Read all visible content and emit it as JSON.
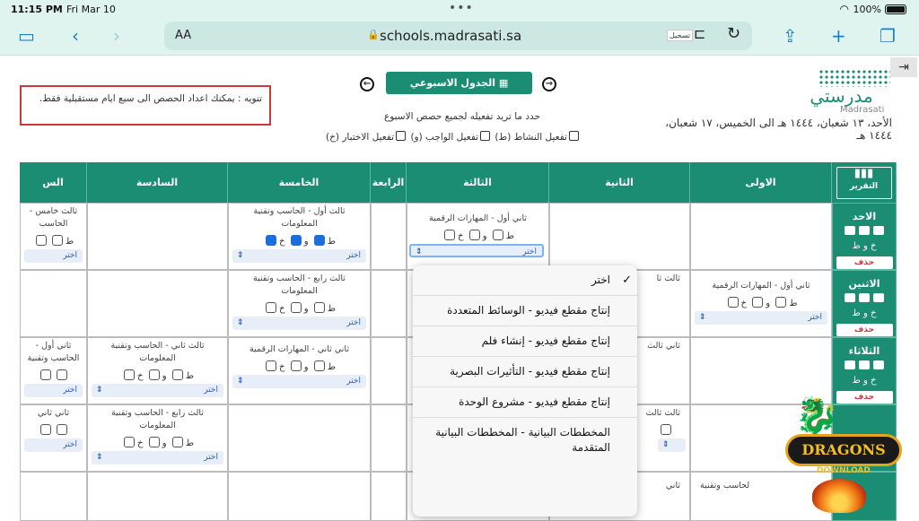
{
  "status": {
    "time": "11:15 PM",
    "date": "Fri Mar 10",
    "battery": "100%"
  },
  "browser": {
    "aa": "AA",
    "url": "schools.madrasati.sa",
    "ext_label": "تسجيل"
  },
  "page": {
    "weekly_button": "الجدول الاسبوعي",
    "notice": "تنويه : يمكنك اعداد الحصص الى سبع ايام مستقبلية فقط.",
    "hint": "حدد ما تريد تفعيله لجميع حصص الاسبوع",
    "activations": [
      "تفعيل النشاط (ط)",
      "تفعيل الواجب (و)",
      "تفعيل الاختبار (خ)"
    ],
    "brand_ar": "مدرستي",
    "brand_en": "Madrasati",
    "date_range": "الأحد، ١٣ شعبان، ١٤٤٤ هـ الى الخميس، ١٧ شعبان، ١٤٤٤ هـ"
  },
  "table": {
    "report_label": "التقرير",
    "columns": [
      "الاولى",
      "الثانية",
      "الثالثة",
      "الرابعة",
      "الخامسة",
      "السادسة",
      "الس"
    ],
    "days": [
      "الاحد",
      "الاثنين",
      "الثلاثاء"
    ],
    "day_marks": "خ و ط",
    "delete_label": "حذف",
    "select_label": "اختر",
    "marks": {
      "t": "ط",
      "w": "و",
      "k": "خ"
    },
    "cells": {
      "sun_c3": "ثاني أول - المهارات الرقمية",
      "sun_c5": "ثالث أول - الحاسب وتقنية المعلومات",
      "sun_c7": "ثالث خامس - الحاسب",
      "mon_c1": "ثاني أول - المهارات الرقمية",
      "mon_c2": "ثالث ثا",
      "mon_c5": "ثالث رابع - الحاسب وتقنية المعلومات",
      "tue_c2": "ثاني ثالث",
      "tue_c5": "ثاني ثاني - المهارات الرقمية",
      "tue_c6": "ثالث ثاني - الحاسب وتقنية المعلومات",
      "tue_c7": "ثاني أول - الحاسب وتقنية",
      "wed_c2": "ثالث ثالث",
      "wed_c6": "ثالث رابع - الحاسب وتقنية المعلومات",
      "wed_c7": "ثاني ثاني",
      "thu_c2": "ثاني",
      "thu_c1": "لحاسب وتقنية"
    }
  },
  "dropdown": {
    "options": [
      "اختر",
      "إنتاج مقطع فيديو - الوسائط المتعددة",
      "إنتاج مقطع فيديو - إنشاء فلم",
      "إنتاج مقطع فيديو - التأثيرات البصرية",
      "إنتاج مقطع فيديو - مشروع الوحدة",
      "المخططات البيانية - المخططات البيانية المتقدمة"
    ],
    "checked_index": 0
  },
  "watermark": {
    "title": "DRAGONS",
    "subtitle": "DOWNLOAD"
  },
  "colors": {
    "brand": "#1a8d73",
    "header_bg": "#dff3ef",
    "danger": "#c93a3a",
    "link": "#2a5fb7"
  }
}
